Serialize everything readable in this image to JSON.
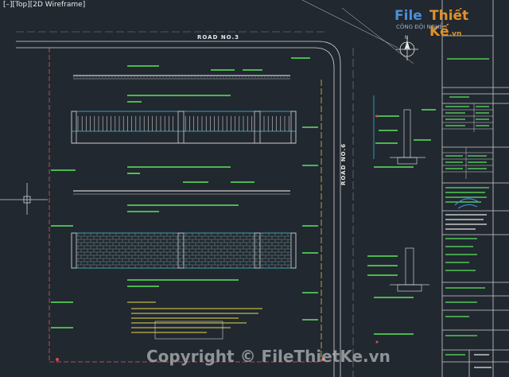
{
  "viewport": {
    "label": "[–][Top][2D Wireframe]"
  },
  "drawing": {
    "road_top": "ROAD NO.3",
    "road_right": "ROAD NO.6"
  },
  "title_block": {
    "compass_north": "N"
  },
  "watermark": {
    "logo_part1": "File",
    "logo_part2": "Thiết Kế",
    "logo_suffix": ".vn",
    "logo_sub": "CÔNG ĐỘI NGHỀ",
    "copyright": "Copyright © FileThietKe.vn"
  },
  "colors": {
    "background": "#212830",
    "fence_cyan": "#3ec4d4",
    "annotation_green": "#5ce65c",
    "line_white": "#d9d9d9",
    "accent_red": "#e04a4a",
    "accent_yellow": "#e8d84a"
  }
}
